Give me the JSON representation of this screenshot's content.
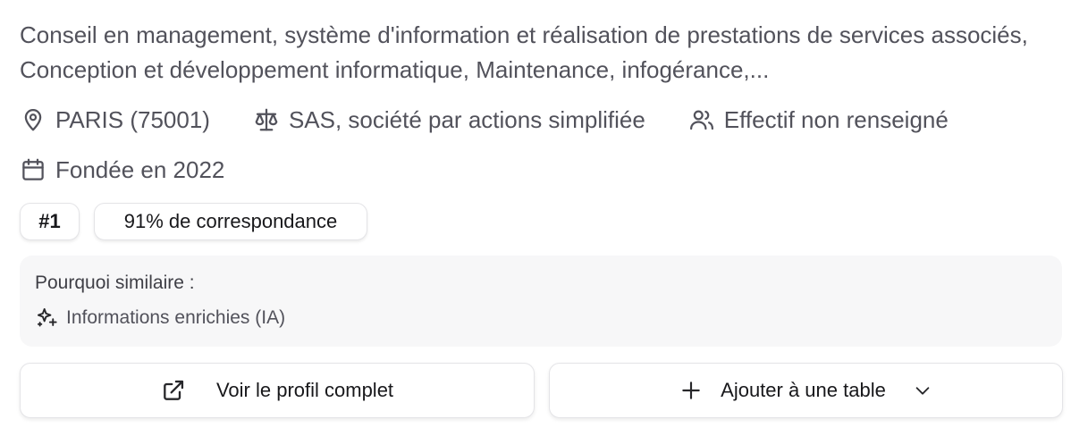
{
  "company": {
    "description": "Conseil en management, système d'information et réalisation de prestations de services associés, Conception et développement informatique, Maintenance, infogérance,...",
    "location": "PARIS (75001)",
    "legal_form": "SAS, société par actions simplifiée",
    "headcount": "Effectif non renseigné",
    "founded": "Fondée en 2022"
  },
  "badges": {
    "rank": "#1",
    "match": "91% de correspondance"
  },
  "similarity": {
    "title": "Pourquoi similaire :",
    "reasons": [
      "Informations enrichies (IA)"
    ]
  },
  "actions": {
    "view_profile": "Voir le profil complet",
    "add_to_table": "Ajouter à une table"
  },
  "icons": {
    "location": "map-pin-icon",
    "legal": "scale-icon",
    "headcount": "users-icon",
    "founded": "calendar-icon",
    "ai": "sparkles-icon",
    "external": "external-link-icon",
    "add": "plus-icon",
    "dropdown": "chevron-down-icon"
  }
}
